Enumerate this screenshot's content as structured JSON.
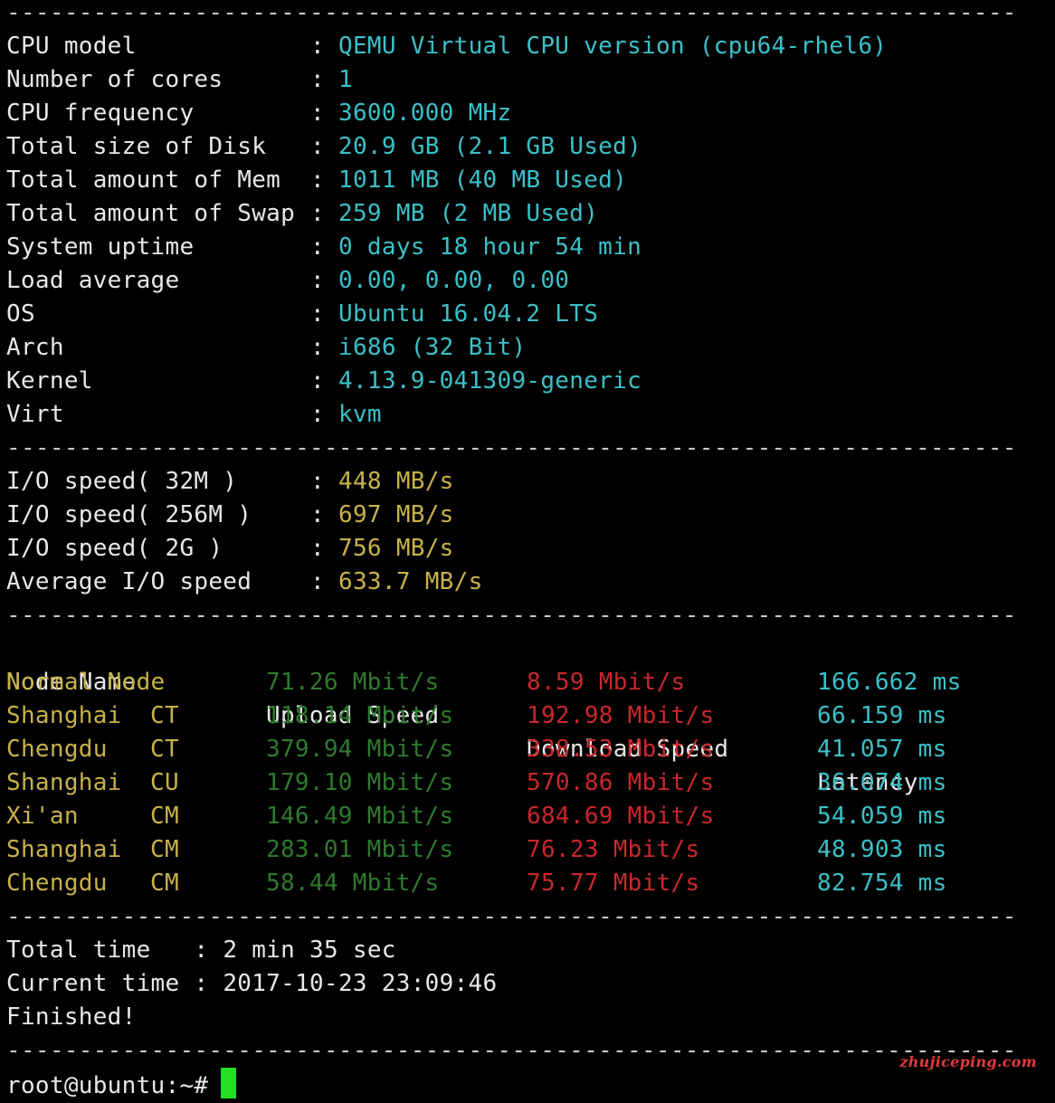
{
  "separator": "----------------------------------------------------------------------",
  "colon": ":",
  "system_info": [
    {
      "key": "CPU model",
      "value": "QEMU Virtual CPU version (cpu64-rhel6)"
    },
    {
      "key": "Number of cores",
      "value": "1"
    },
    {
      "key": "CPU frequency",
      "value": "3600.000 MHz"
    },
    {
      "key": "Total size of Disk",
      "value": "20.9 GB (2.1 GB Used)"
    },
    {
      "key": "Total amount of Mem",
      "value": "1011 MB (40 MB Used)"
    },
    {
      "key": "Total amount of Swap",
      "value": "259 MB (2 MB Used)"
    },
    {
      "key": "System uptime",
      "value": "0 days 18 hour 54 min"
    },
    {
      "key": "Load average",
      "value": "0.00, 0.00, 0.00"
    },
    {
      "key": "OS",
      "value": "Ubuntu 16.04.2 LTS"
    },
    {
      "key": "Arch",
      "value": "i686 (32 Bit)"
    },
    {
      "key": "Kernel",
      "value": "4.13.9-041309-generic"
    },
    {
      "key": "Virt",
      "value": "kvm"
    }
  ],
  "io_info": [
    {
      "key": "I/O speed( 32M )",
      "value": "448 MB/s"
    },
    {
      "key": "I/O speed( 256M )",
      "value": "697 MB/s"
    },
    {
      "key": "I/O speed( 2G )",
      "value": "756 MB/s"
    },
    {
      "key": "Average I/O speed",
      "value": "633.7 MB/s"
    }
  ],
  "speed_table": {
    "headers": {
      "node": "Node Name",
      "upload": "Upload Speed",
      "download": "Download Speed",
      "latency": "Latency"
    },
    "rows": [
      {
        "node": "Normal Node",
        "isp": "",
        "upload": "71.26 Mbit/s",
        "download": "8.59 Mbit/s",
        "latency": "166.662 ms"
      },
      {
        "node": "Shanghai",
        "isp": "CT",
        "upload": "118.14 Mbit/s",
        "download": "192.98 Mbit/s",
        "latency": "66.159 ms"
      },
      {
        "node": "Chengdu",
        "isp": "CT",
        "upload": "379.94 Mbit/s",
        "download": "338.53 Mbit/s",
        "latency": "41.057 ms"
      },
      {
        "node": "Shanghai",
        "isp": "CU",
        "upload": "179.10 Mbit/s",
        "download": "570.86 Mbit/s",
        "latency": "36.074 ms"
      },
      {
        "node": "Xi'an",
        "isp": "CM",
        "upload": "146.49 Mbit/s",
        "download": "684.69 Mbit/s",
        "latency": "54.059 ms"
      },
      {
        "node": "Shanghai",
        "isp": "CM",
        "upload": "283.01 Mbit/s",
        "download": "76.23 Mbit/s",
        "latency": "48.903 ms"
      },
      {
        "node": "Chengdu",
        "isp": "CM",
        "upload": "58.44 Mbit/s",
        "download": "75.77 Mbit/s",
        "latency": "82.754 ms"
      }
    ]
  },
  "summary": {
    "total_time_label": "Total time   : ",
    "total_time": "2 min 35 sec",
    "current_time_label": "Current time : ",
    "current_time": "2017-10-23 23:09:46",
    "finished": "Finished!"
  },
  "prompt": "root@ubuntu:~#",
  "watermark": "zhujiceping.com",
  "colors": {
    "background": "#000000",
    "text": "#e8e8e8",
    "cyan": "#3bc0c8",
    "yellow": "#c8b24a",
    "green": "#2f7a2f",
    "red": "#c8282c",
    "cursor": "#22e022"
  }
}
